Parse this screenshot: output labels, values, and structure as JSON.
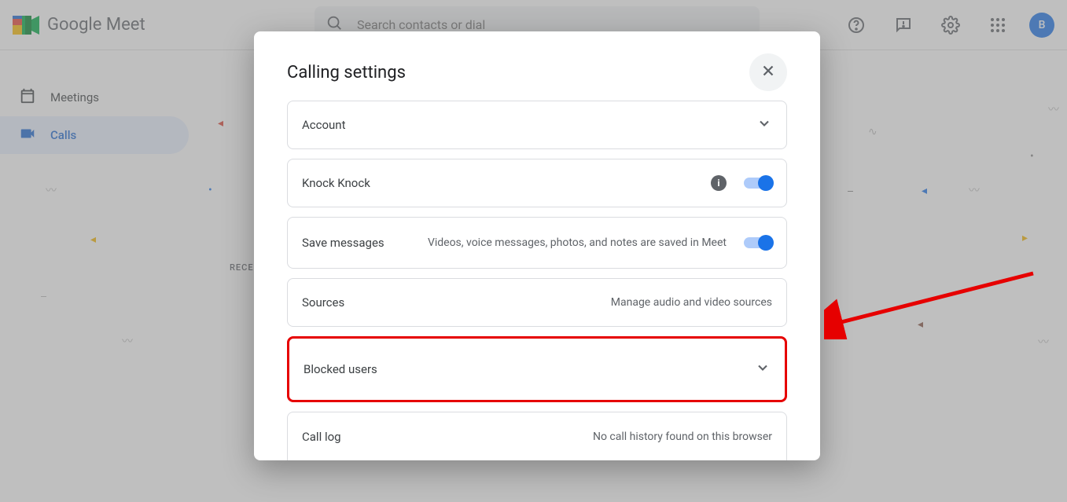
{
  "header": {
    "app_name": "Google Meet",
    "search_placeholder": "Search contacts or dial",
    "avatar_initial": "B"
  },
  "sidebar": {
    "items": [
      {
        "label": "Meetings"
      },
      {
        "label": "Calls"
      }
    ],
    "recent_heading": "RECENT"
  },
  "modal": {
    "title": "Calling settings",
    "rows": {
      "account": {
        "label": "Account"
      },
      "knock": {
        "label": "Knock Knock"
      },
      "save_messages": {
        "label": "Save messages",
        "sub": "Videos, voice messages, photos, and notes are saved in Meet"
      },
      "sources": {
        "label": "Sources",
        "sub": "Manage audio and video sources"
      },
      "blocked": {
        "label": "Blocked users"
      },
      "call_log": {
        "label": "Call log",
        "sub": "No call history found on this browser"
      }
    }
  }
}
